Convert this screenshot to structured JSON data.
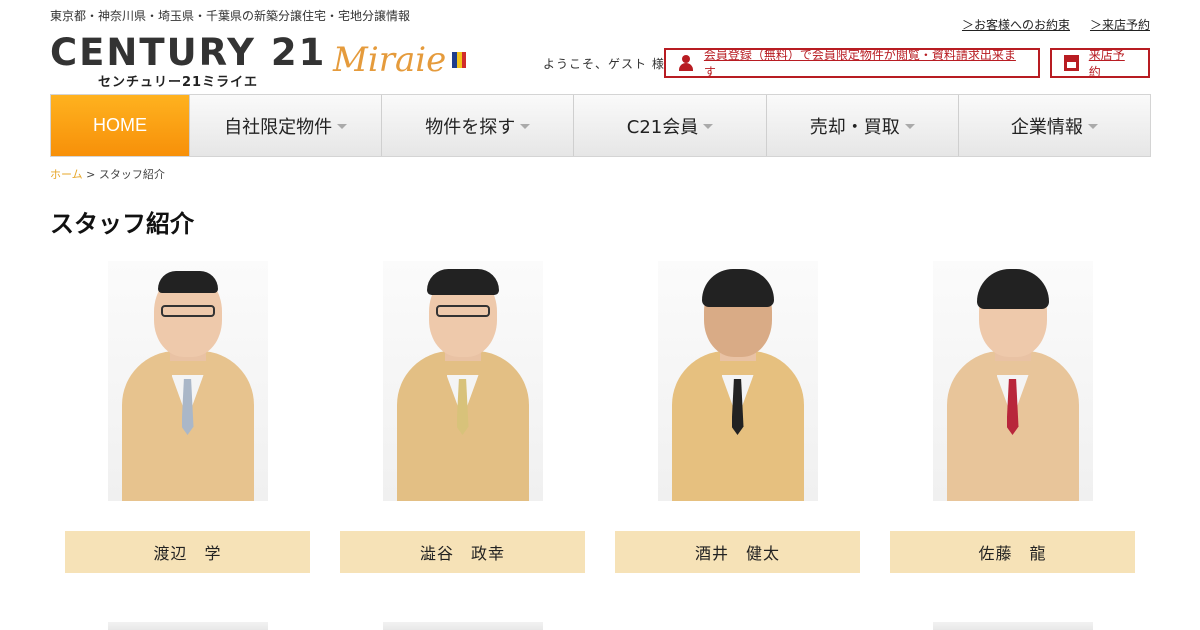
{
  "header": {
    "tagline": "東京都・神奈川県・埼玉県・千葉県の新築分譲住宅・宅地分譲情報",
    "promise_link": "＞お客様へのお約束",
    "visit_link": "＞来店予約",
    "logo_main": "CENTURY 21",
    "logo_sub": "センチュリー21ミライエ",
    "brand_script": "Miraie",
    "welcome": "ようこそ、ゲスト 様",
    "register_button": "会員登録（無料）で会員限定物件が閲覧・資料請求出来ます",
    "visit_button": "来店予約"
  },
  "colors": {
    "accent": "#f79009",
    "red": "#b81c22",
    "nameplate": "#f6e2b7",
    "crumb": "#e7a72a"
  },
  "nav": [
    {
      "label": "HOME"
    },
    {
      "label": "自社限定物件"
    },
    {
      "label": "物件を探す"
    },
    {
      "label": "C21会員"
    },
    {
      "label": "売却・買取"
    },
    {
      "label": "企業情報"
    }
  ],
  "breadcrumb": {
    "home": "ホーム",
    "separator": " > ",
    "current": "スタッフ紹介"
  },
  "page_title": "スタッフ紹介",
  "staff": [
    {
      "name": "渡辺　学"
    },
    {
      "name": "澁谷　政幸"
    },
    {
      "name": "酒井　健太"
    },
    {
      "name": "佐藤　龍"
    }
  ]
}
